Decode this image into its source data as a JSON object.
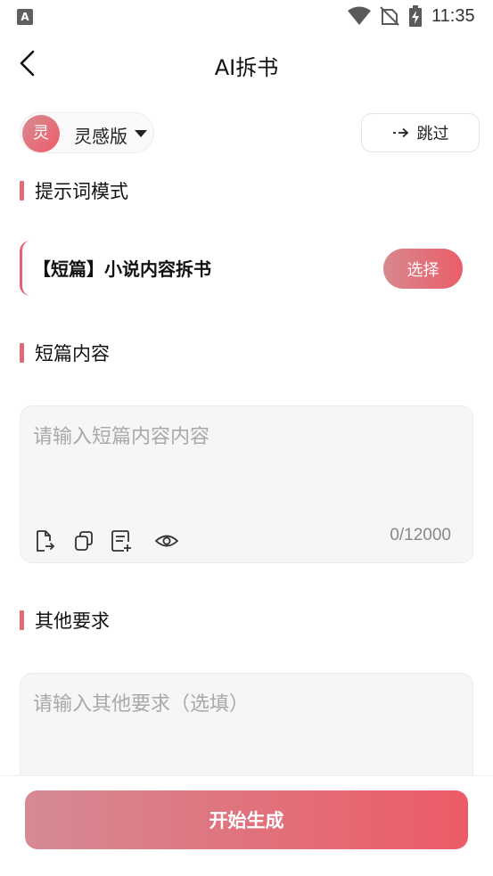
{
  "status_bar": {
    "app_icon_letter": "A",
    "time": "11:35"
  },
  "header": {
    "title": "AI拆书"
  },
  "version": {
    "avatar_char": "灵",
    "label": "灵感版"
  },
  "skip": {
    "label": "跳过"
  },
  "sections": {
    "prompt_mode": "提示词模式",
    "short_content": "短篇内容",
    "other_requirements": "其他要求"
  },
  "prompt_card": {
    "title": "【短篇】小说内容拆书",
    "select_label": "选择"
  },
  "content_box": {
    "placeholder": "请输入短篇内容内容",
    "counter": "0/12000",
    "tools": [
      "file-import-icon",
      "copy-icon",
      "add-note-icon",
      "eye-icon"
    ]
  },
  "requirements_box": {
    "placeholder": "请输入其他要求（选填）"
  },
  "footer": {
    "start_label": "开始生成"
  },
  "colors": {
    "accent": "#e5626e",
    "accent_light": "#d8888f"
  }
}
